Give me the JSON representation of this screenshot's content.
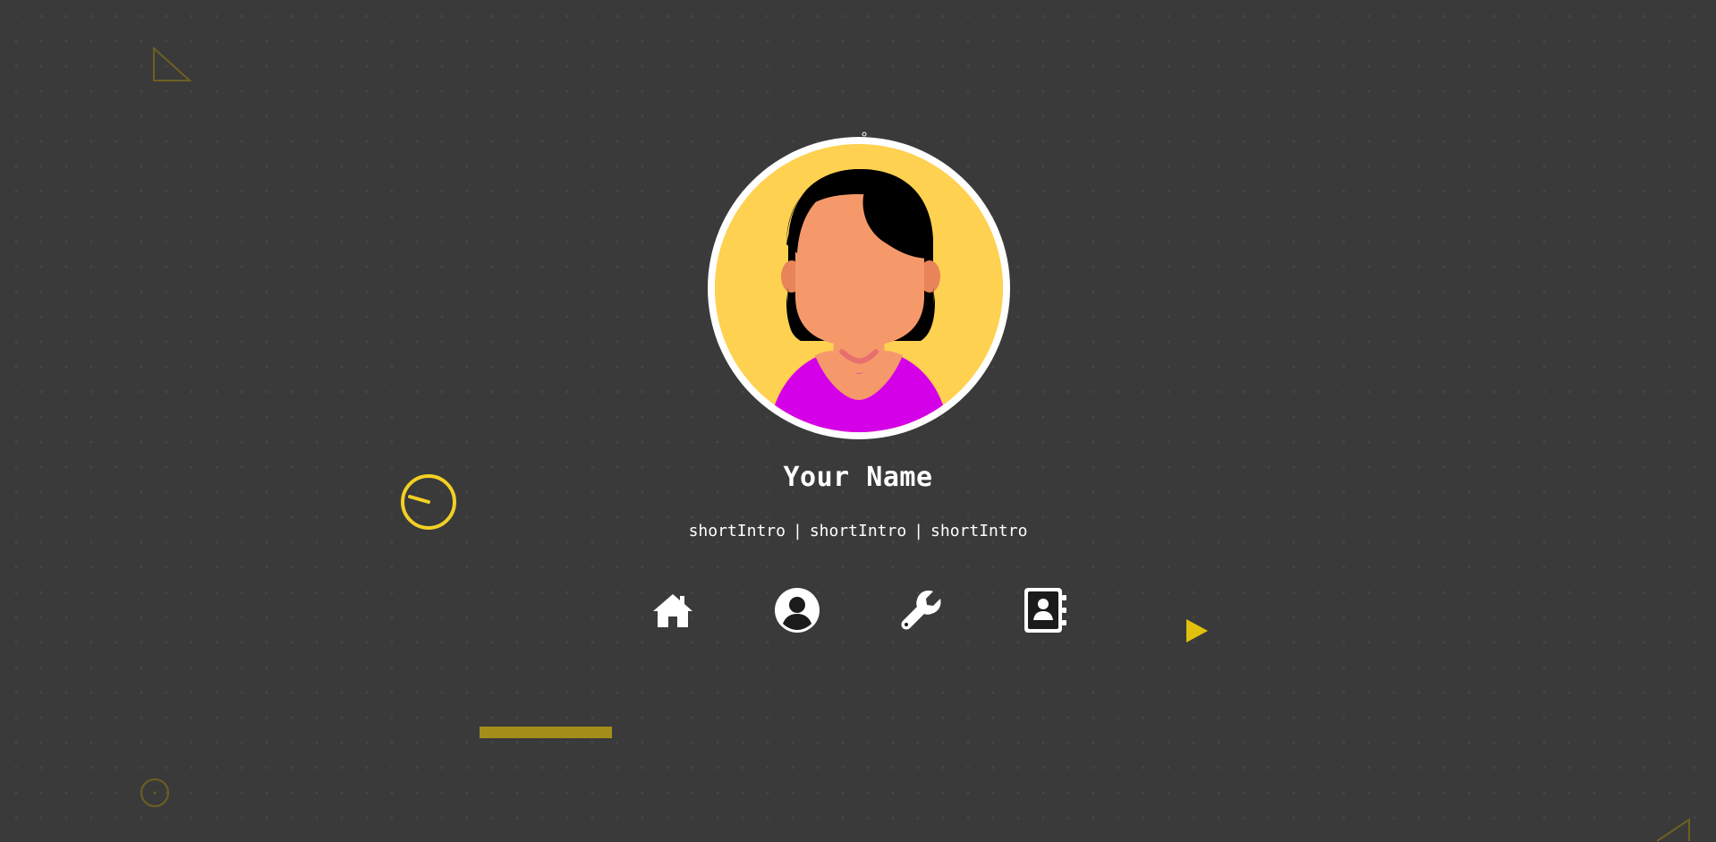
{
  "profile": {
    "name": "Your Name",
    "intros": [
      "shortIntro",
      "shortIntro",
      "shortIntro"
    ],
    "separator": "|",
    "avatar_icon": "avatar-illustration-icon"
  },
  "nav": [
    {
      "id": "home",
      "icon": "home-icon"
    },
    {
      "id": "about",
      "icon": "user-circle-icon"
    },
    {
      "id": "skills",
      "icon": "wrench-icon"
    },
    {
      "id": "contact",
      "icon": "address-book-icon"
    }
  ],
  "colors": {
    "background": "#1b1b1b",
    "accent": "#f2d024",
    "accent_dim": "#7a6a1a",
    "avatar_bg": "#ffd151",
    "skin": "#f5996b",
    "shirt": "#d400e8",
    "text": "#ffffff"
  }
}
